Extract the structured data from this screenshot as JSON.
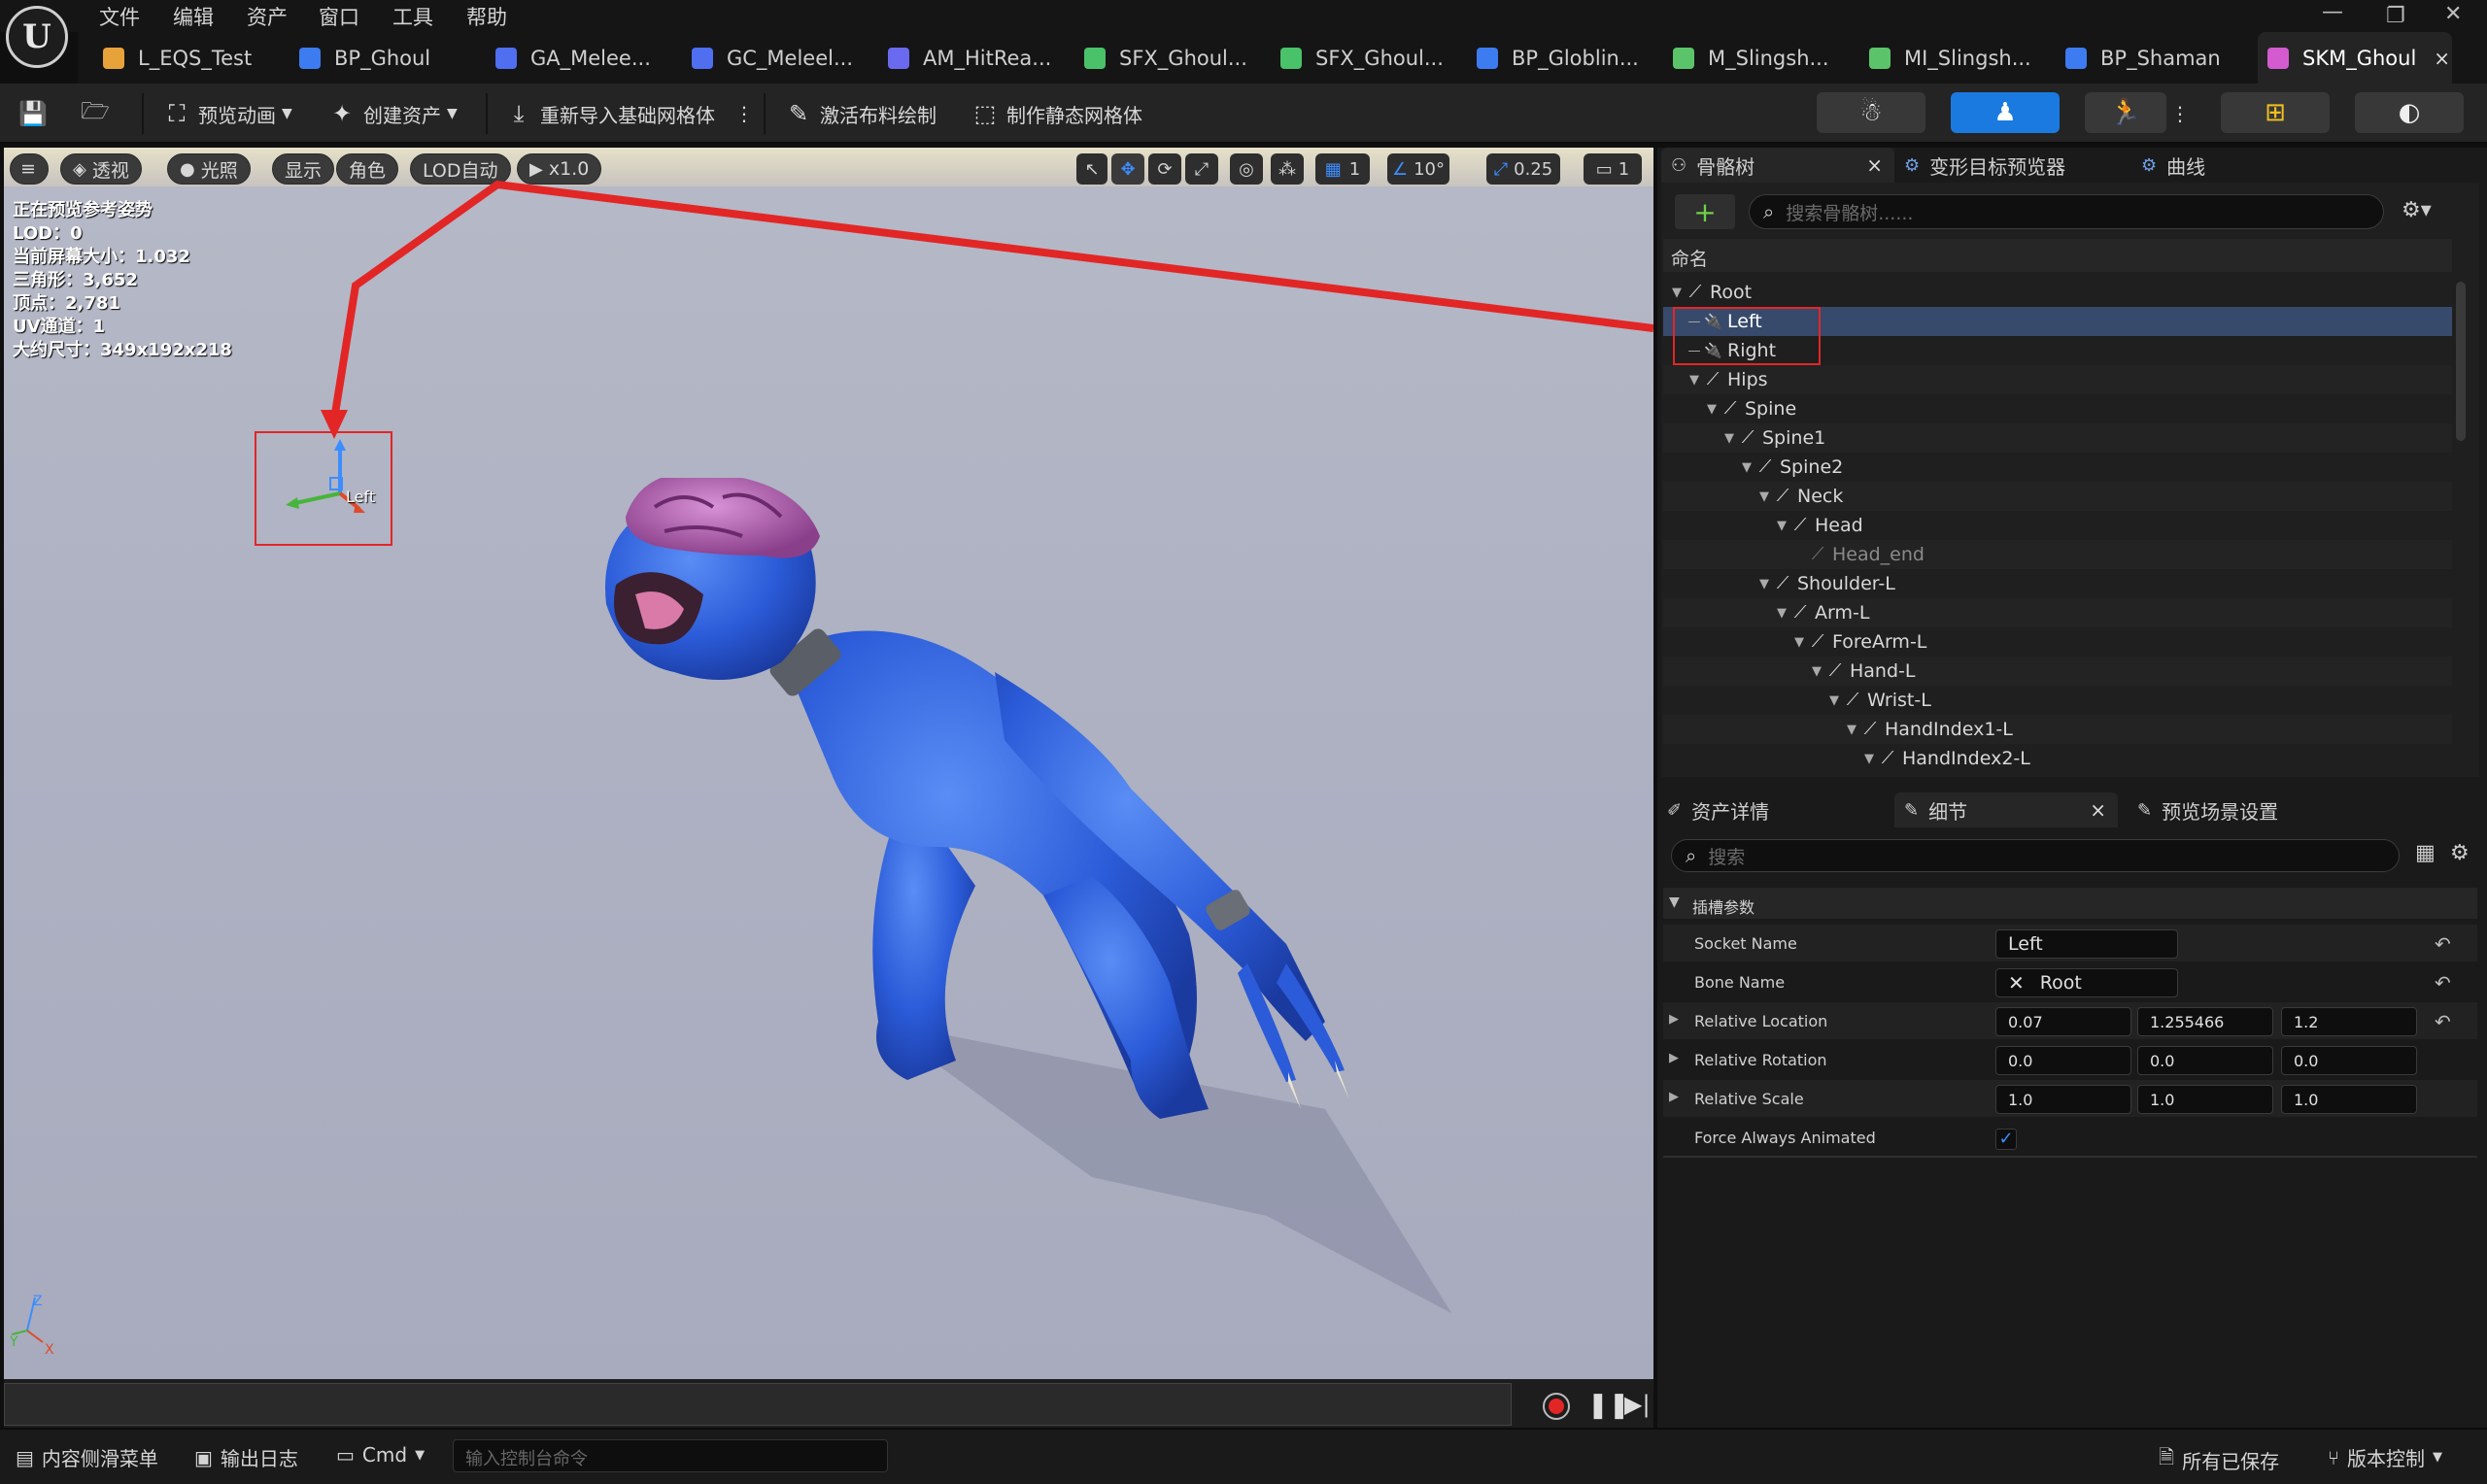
{
  "app": {
    "menu": [
      "文件",
      "编辑",
      "资产",
      "窗口",
      "工具",
      "帮助"
    ],
    "logo": "U"
  },
  "tabs": [
    {
      "label": "L_EQS_Test",
      "color": "#e8a23a"
    },
    {
      "label": "BP_Ghoul",
      "color": "#3d7bf0"
    },
    {
      "label": "GA_Melee...",
      "color": "#4f6ef0"
    },
    {
      "label": "GC_Meleel...",
      "color": "#4f6ef0"
    },
    {
      "label": "AM_HitRea...",
      "color": "#6a6af0"
    },
    {
      "label": "SFX_Ghoul...",
      "color": "#49c26a"
    },
    {
      "label": "SFX_Ghoul...",
      "color": "#49c26a"
    },
    {
      "label": "BP_Globlin...",
      "color": "#3d7bf0"
    },
    {
      "label": "M_Slingsh...",
      "color": "#5bc46a"
    },
    {
      "label": "MI_Slingsh...",
      "color": "#5bc46a"
    },
    {
      "label": "BP_Shaman",
      "color": "#3d7bf0"
    },
    {
      "label": "SKM_Ghoul",
      "color": "#d45ad0",
      "active": true,
      "close": "×"
    }
  ],
  "toolbar": {
    "preview_anim": "预览动画",
    "create_asset": "创建资产",
    "reimport": "重新导入基础网格体",
    "cloth": "激活布料绘制",
    "static_mesh": "制作静态网格体"
  },
  "viewport": {
    "buttons": {
      "menu": "≡",
      "perspective": "透视",
      "lit": "光照",
      "show": "显示",
      "character": "角色",
      "lod": "LOD自动",
      "speed": "x1.0"
    },
    "right_controls": {
      "grid_value": "1",
      "angle_value": "10°",
      "scale_value": "0.25",
      "camera_value": "1"
    },
    "stats": [
      "正在预览参考姿势",
      "LOD：0",
      "当前屏幕大小：1.032",
      "三角形：3,652",
      "顶点：2,781",
      "UV通道：1",
      "大约尺寸：349x192x218"
    ],
    "socket_label": "Left",
    "axis": {
      "z": "Z",
      "x": "X",
      "y": "Y"
    }
  },
  "colors": {
    "highlight_red": "#e22626",
    "accent_blue": "#1a7ae0",
    "selection": "#374a6c"
  },
  "skeleton_panel": {
    "tabs": [
      {
        "label": "骨骼树",
        "close": "×"
      },
      {
        "label": "变形目标预览器"
      },
      {
        "label": "曲线"
      }
    ],
    "search_placeholder": "搜索骨骼树......",
    "add_label": "+",
    "column_name": "命名",
    "tree": [
      {
        "label": "Root",
        "depth": 0,
        "expanded": true,
        "type": "bone"
      },
      {
        "label": "Left",
        "depth": 1,
        "type": "socket",
        "selected": true
      },
      {
        "label": "Right",
        "depth": 1,
        "type": "socket"
      },
      {
        "label": "Hips",
        "depth": 1,
        "expanded": true,
        "type": "bone"
      },
      {
        "label": "Spine",
        "depth": 2,
        "expanded": true,
        "type": "bone"
      },
      {
        "label": "Spine1",
        "depth": 3,
        "expanded": true,
        "type": "bone"
      },
      {
        "label": "Spine2",
        "depth": 4,
        "expanded": true,
        "type": "bone"
      },
      {
        "label": "Neck",
        "depth": 5,
        "expanded": true,
        "type": "bone"
      },
      {
        "label": "Head",
        "depth": 6,
        "expanded": true,
        "type": "bone"
      },
      {
        "label": "Head_end",
        "depth": 7,
        "type": "bone-dim"
      },
      {
        "label": "Shoulder-L",
        "depth": 5,
        "expanded": true,
        "type": "bone"
      },
      {
        "label": "Arm-L",
        "depth": 6,
        "expanded": true,
        "type": "bone"
      },
      {
        "label": "ForeArm-L",
        "depth": 7,
        "expanded": true,
        "type": "bone"
      },
      {
        "label": "Hand-L",
        "depth": 8,
        "expanded": true,
        "type": "bone"
      },
      {
        "label": "Wrist-L",
        "depth": 9,
        "expanded": true,
        "type": "bone"
      },
      {
        "label": "HandIndex1-L",
        "depth": 10,
        "expanded": true,
        "type": "bone"
      },
      {
        "label": "HandIndex2-L",
        "depth": 11,
        "expanded": true,
        "type": "bone"
      }
    ]
  },
  "details_panel": {
    "tabs": [
      {
        "label": "资产详情"
      },
      {
        "label": "细节",
        "close": "×"
      },
      {
        "label": "预览场景设置"
      }
    ],
    "search_placeholder": "搜索",
    "section": "插槽参数",
    "rows": {
      "socket_name": {
        "label": "Socket Name",
        "value": "Left"
      },
      "bone_name": {
        "label": "Bone Name",
        "value": "Root"
      },
      "relative_location": {
        "label": "Relative Location",
        "x": "0.07",
        "y": "1.255466",
        "z": "1.2"
      },
      "relative_rotation": {
        "label": "Relative Rotation",
        "x": "0.0",
        "y": "0.0",
        "z": "0.0"
      },
      "relative_scale": {
        "label": "Relative Scale",
        "x": "1.0",
        "y": "1.0",
        "z": "1.0"
      },
      "force_animated": {
        "label": "Force Always Animated",
        "checked": true
      }
    }
  },
  "statusbar": {
    "content_drawer": "内容侧滑菜单",
    "output_log": "输出日志",
    "cmd": "Cmd",
    "console_placeholder": "输入控制台命令",
    "all_saved": "所有已保存",
    "source_control": "版本控制"
  }
}
